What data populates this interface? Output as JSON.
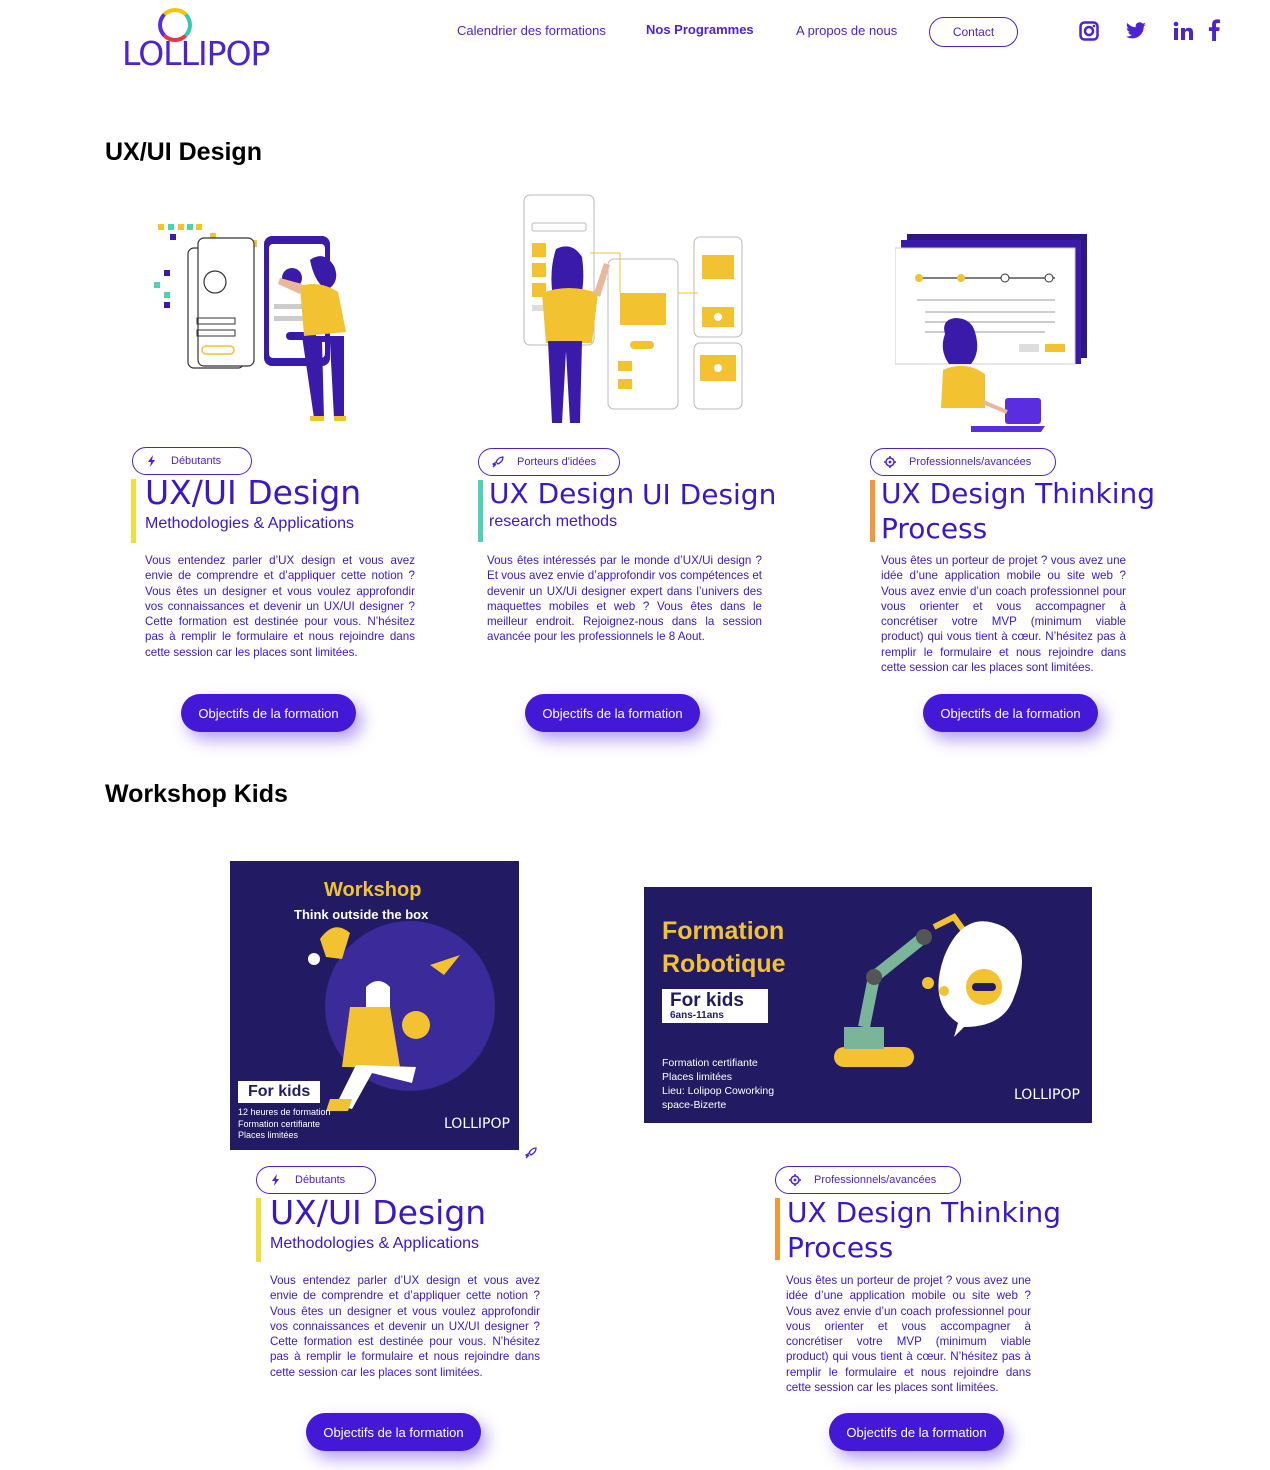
{
  "header": {
    "logo_text": "LOLLIPOP",
    "nav": [
      {
        "label": "Calendrier des formations"
      },
      {
        "label": "Nos Programmes"
      },
      {
        "label": "A propos de nous"
      }
    ],
    "contact_label": "Contact",
    "social_icons": [
      "instagram-icon",
      "twitter-icon",
      "linkedin-icon",
      "facebook-icon"
    ]
  },
  "sections": {
    "uxui_title": "UX/UI Design",
    "workshop_title": "Workshop Kids"
  },
  "cards": [
    {
      "level": "Débutants",
      "title": "UX/UI Design",
      "subtitle": "Methodologies & Applications",
      "description": "Vous entendez parler d’UX design et vous avez envie de comprendre et d’appliquer cette notion ? Vous êtes un designer et vous voulez approfondir vos connaissances et devenir un UX/UI designer ? Cette formation est destinée pour vous. N’hésitez pas à remplir le formulaire et nous rejoindre dans cette session car les places sont limitées.",
      "cta": "Objectifs de la formation",
      "accent_color": "#f2de3a"
    },
    {
      "level": "Porteurs d'idées",
      "title": "UX Design",
      "title_extra": "UI Design",
      "subtitle": "research methods",
      "description": "Vous êtes intéressés par le monde d’UX/Ui design ? Et vous avez envie d’approfondir vos compétences et devenir un UX/Ui designer expert dans l’univers des maquettes mobiles et web ? Vous êtes dans le meilleur endroit.  Rejoignez-nous dans la session avancée pour les professionnels le 8 Aout.",
      "cta": "Objectifs de la formation",
      "accent_color": "#4fd1b5"
    },
    {
      "level": "Professionnels/avancées",
      "title_line1": "UX Design Thinking",
      "title_line2": "Process",
      "description": "Vous êtes un porteur de projet ? vous avez une idée d’une application mobile ou site web ? Vous avez envie d’un coach professionnel pour vous orienter et vous accompagner à concrétiser votre MVP (minimum viable product) qui vous tient à cœur. N’hésitez pas à remplir le formulaire et nous rejoindre dans cette session car les places sont limitées.",
      "cta": "Objectifs de la formation",
      "accent_color": "#f0983a"
    }
  ],
  "workshop_cards": [
    {
      "level": "Débutants",
      "title": "UX/UI Design",
      "subtitle": "Methodologies & Applications",
      "description": "Vous entendez parler d’UX design et vous avez envie de comprendre et d’appliquer cette notion ? Vous êtes un designer et vous voulez approfondir vos connaissances et devenir un UX/UI designer ? Cette formation est destinée pour vous. N’hésitez pas à remplir le formulaire et nous rejoindre dans cette session car les places sont limitées.",
      "cta": "Objectifs de la formation"
    },
    {
      "level": "Professionnels/avancées",
      "title_line1": "UX Design Thinking",
      "title_line2": "Process",
      "description": "Vous êtes un porteur de projet ? vous avez une idée d’une application mobile ou site web ? Vous avez envie d’un coach professionnel pour vous orienter et vous accompagner à concrétiser votre MVP (minimum viable product) qui vous tient à cœur. N’hésitez pas à remplir le formulaire et nous rejoindre dans cette session car les places sont limitées.",
      "cta": "Objectifs de la formation"
    }
  ],
  "posters": {
    "workshop": {
      "title": "Workshop",
      "subtitle": "Think outside the box",
      "badge": "For kids",
      "lines": [
        "12 heures de formation",
        "Formation certifiante",
        "Places limitées"
      ],
      "brand": "LOLLIPOP"
    },
    "robotique": {
      "title_line1": "Formation",
      "title_line2": "Robotique",
      "badge": "For kids",
      "badge_sub": "6ans-11ans",
      "lines": [
        "Formation certifiante",
        "Places limitées",
        "Lieu: Lolipop Coworking",
        "space-Bizerte"
      ],
      "brand": "LOLLIPOP"
    }
  },
  "colors": {
    "brand": "#4c22d3",
    "title": "#3b17c8",
    "cta": "#4318d6",
    "poster_bg": "#221b63",
    "yellow": "#f2c230"
  }
}
